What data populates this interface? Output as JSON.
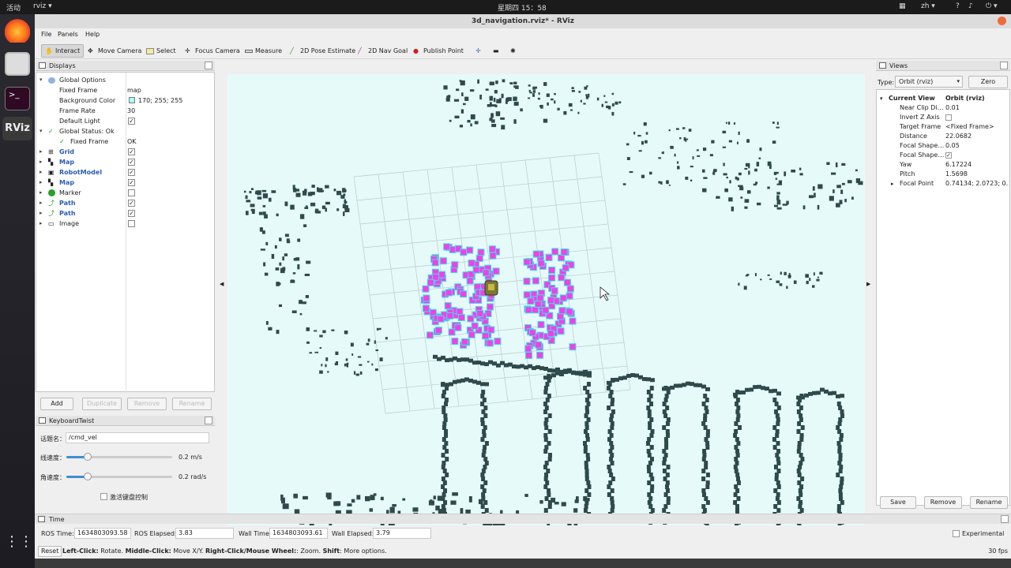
{
  "topbar": {
    "activities": "活动",
    "app": "rviz",
    "clock": "星期四 15：58",
    "lang": "zh"
  },
  "window": {
    "title": "3d_navigation.rviz* - RViz"
  },
  "menu": {
    "file": "File",
    "panels": "Panels",
    "help": "Help"
  },
  "toolbar": {
    "interact": "Interact",
    "move_camera": "Move Camera",
    "select": "Select",
    "focus_camera": "Focus Camera",
    "measure": "Measure",
    "pose_estimate": "2D Pose Estimate",
    "nav_goal": "2D Nav Goal",
    "publish_point": "Publish Point"
  },
  "displays": {
    "title": "Displays",
    "global_options": "Global Options",
    "fixed_frame_label": "Fixed Frame",
    "fixed_frame_value": "map",
    "bg_color_label": "Background Color",
    "bg_color_value": "170; 255; 255",
    "bg_color_hex": "#aaffff",
    "frame_rate_label": "Frame Rate",
    "frame_rate_value": "30",
    "default_light_label": "Default Light",
    "global_status": "Global Status: Ok",
    "status_fixed_frame": "Fixed Frame",
    "status_fixed_frame_value": "OK",
    "items": [
      {
        "label": "Grid",
        "checked": true
      },
      {
        "label": "Map",
        "checked": true
      },
      {
        "label": "RobotModel",
        "checked": true
      },
      {
        "label": "Map",
        "checked": true
      },
      {
        "label": "Marker",
        "checked": false
      },
      {
        "label": "Path",
        "checked": true
      },
      {
        "label": "Path",
        "checked": true
      },
      {
        "label": "Image",
        "checked": false
      }
    ],
    "buttons": {
      "add": "Add",
      "duplicate": "Duplicate",
      "remove": "Remove",
      "rename": "Rename"
    }
  },
  "keyboard": {
    "title": "KeyboardTwist",
    "topic_label": "话题名：",
    "topic_value": "/cmd_vel",
    "linear_label": "线速度：",
    "linear_value": "0.2 m/s",
    "linear_level": 0.2,
    "angular_label": "角速度：",
    "angular_value": "0.2 rad/s",
    "angular_level": 0.2,
    "enable_label": "激活键盘控制"
  },
  "views": {
    "title": "Views",
    "type_label": "Type:",
    "type_value": "Orbit (rviz)",
    "zero": "Zero",
    "current_view": "Current View",
    "current_view_value": "Orbit (rviz)",
    "props": [
      {
        "label": "Near Clip Di…",
        "value": "0.01"
      },
      {
        "label": "Invert Z Axis",
        "value": ""
      },
      {
        "label": "Target Frame",
        "value": "<Fixed Frame>"
      },
      {
        "label": "Distance",
        "value": "22.0682"
      },
      {
        "label": "Focal Shape…",
        "value": "0.05"
      },
      {
        "label": "Focal Shape…",
        "value": ""
      },
      {
        "label": "Yaw",
        "value": "6.17224"
      },
      {
        "label": "Pitch",
        "value": "1.5698"
      },
      {
        "label": "Focal Point",
        "value": "0.74134; 2.0723; 0.2…"
      }
    ],
    "buttons": {
      "save": "Save",
      "remove": "Remove",
      "rename": "Rename"
    }
  },
  "time": {
    "title": "Time",
    "ros_time_label": "ROS Time:",
    "ros_time": "1634803093.58",
    "ros_elapsed_label": "ROS Elapsed:",
    "ros_elapsed": "3.83",
    "wall_time_label": "Wall Time:",
    "wall_time": "1634803093.61",
    "wall_elapsed_label": "Wall Elapsed:",
    "wall_elapsed": "3.79",
    "experimental": "Experimental"
  },
  "status": {
    "reset": "Reset",
    "hint_lc": "Left-Click:",
    "hint_lc_t": " Rotate. ",
    "hint_mc": "Middle-Click:",
    "hint_mc_t": " Move X/Y. ",
    "hint_rc": "Right-Click/Mouse Wheel:",
    "hint_rc_t": ": Zoom. ",
    "hint_sh": "Shift",
    "hint_sh_t": ": More options.",
    "fps": "30 fps"
  },
  "colors": {
    "obstacle": "#2f4a4a",
    "costmap_pink": "#f040e8",
    "costmap_cyan": "#38e0e8",
    "background": "#e6fafa"
  }
}
